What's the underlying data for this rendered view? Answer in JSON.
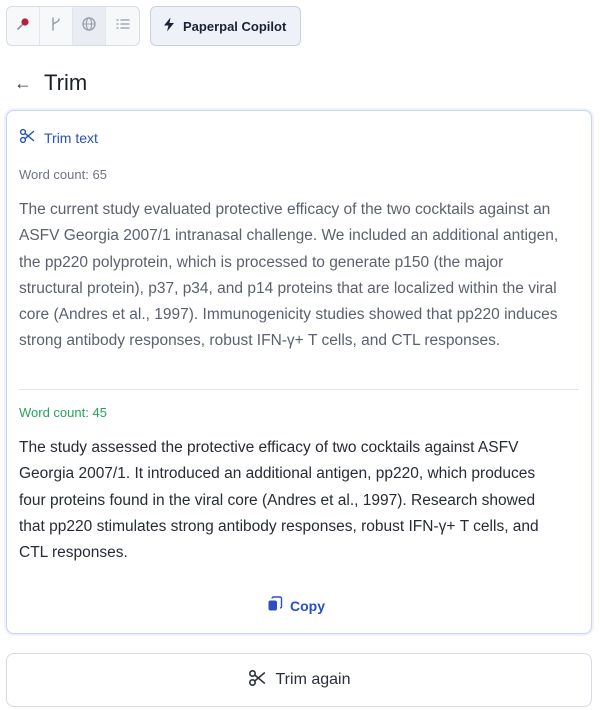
{
  "toolbar": {
    "tools": [
      {
        "icon": "pin-icon",
        "active": false
      },
      {
        "icon": "branch-icon",
        "active": false
      },
      {
        "icon": "globe-icon",
        "active": true
      },
      {
        "icon": "list-icon",
        "active": false
      }
    ],
    "copilot_label": "Paperpal Copilot"
  },
  "header": {
    "title": "Trim"
  },
  "card": {
    "heading": "Trim text",
    "original_word_count": "Word count: 65",
    "original_text": "The current study evaluated protective efficacy of the two cocktails against an ASFV Georgia 2007/1 intranasal challenge. We included an additional antigen, the pp220 polyprotein, which is processed to generate p150 (the major structural protein), p37, p34, and p14 proteins that are localized within the viral core (Andres et al., 1997). Immunogenicity studies showed that pp220 induces strong antibody responses, robust IFN-γ+ T cells, and CTL responses.",
    "trimmed_word_count": "Word count: 45",
    "trimmed_text": "The study assessed the protective efficacy of two cocktails against ASFV Georgia 2007/1. It introduced an additional antigen, pp220, which produces four proteins found in the viral core (Andres et al., 1997). Research showed that pp220 stimulates strong antibody responses, robust IFN-γ+ T cells, and CTL responses.",
    "copy_label": "Copy"
  },
  "actions": {
    "trim_again_label": "Trim again"
  },
  "colors": {
    "accent": "#2a4fbf",
    "success": "#27a35a",
    "border": "#c9d3f0"
  }
}
